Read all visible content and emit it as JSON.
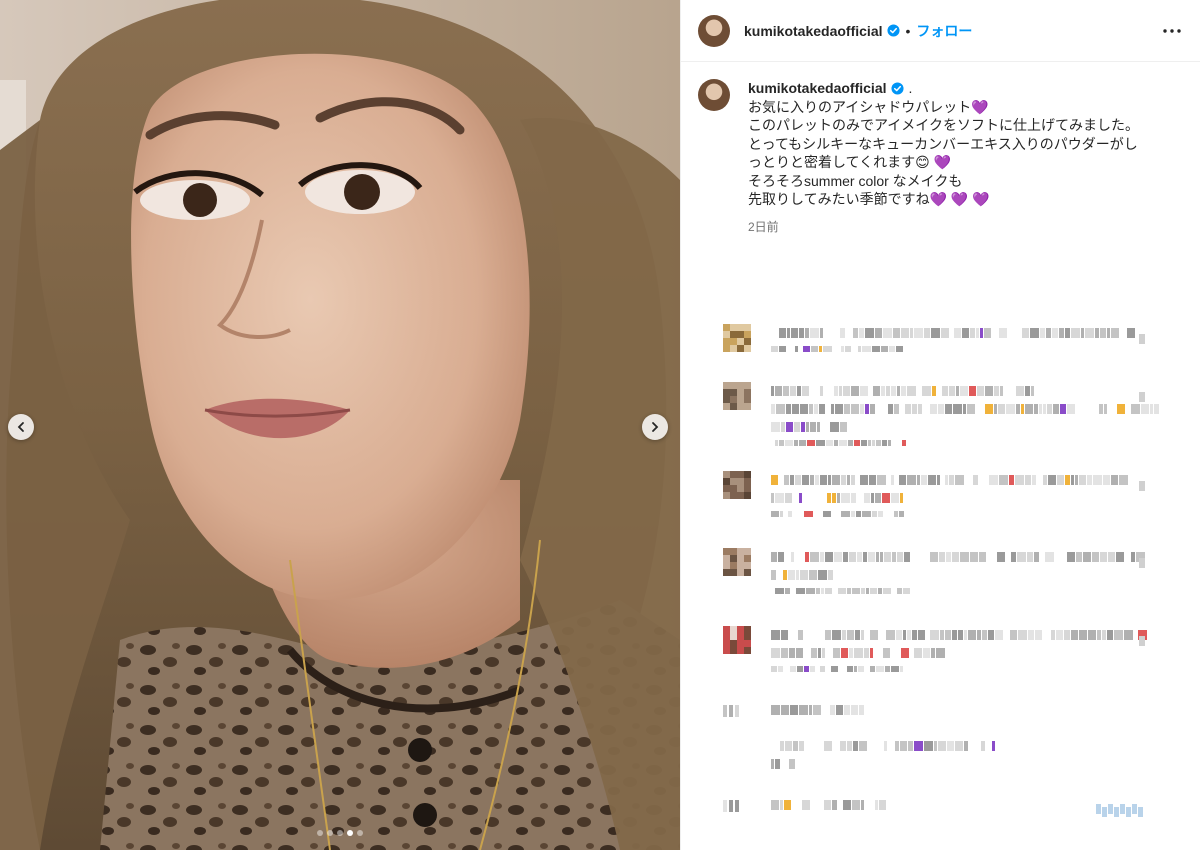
{
  "post": {
    "username": "kumikotakedaofficial",
    "verified": true,
    "separator": "•",
    "follow_label": "フォロー",
    "more_icon": "more-horizontal-icon",
    "caption": {
      "username": "kumikotakedaofficial",
      "trailing": ".",
      "lines": [
        "お気に入りのアイシャドウパレット💜",
        "このパレットのみでアイメイクをソフトに仕上げてみました。",
        "とってもシルキーなキューカンバーエキス入りのパウダーがし",
        "っとりと密着してくれます😊 💜",
        "そろそろsummer color なメイクも",
        "先取りしてみたい季節ですね💜 💜 💜"
      ],
      "time": "2日前"
    },
    "carousel": {
      "slide_count": 5,
      "active_index": 3,
      "prev_icon": "chevron-left-icon",
      "next_icon": "chevron-right-icon"
    }
  },
  "colors": {
    "link": "#0095f6",
    "text": "#262626",
    "muted": "#737373",
    "border": "#efefef",
    "verified": "#0095f6"
  }
}
